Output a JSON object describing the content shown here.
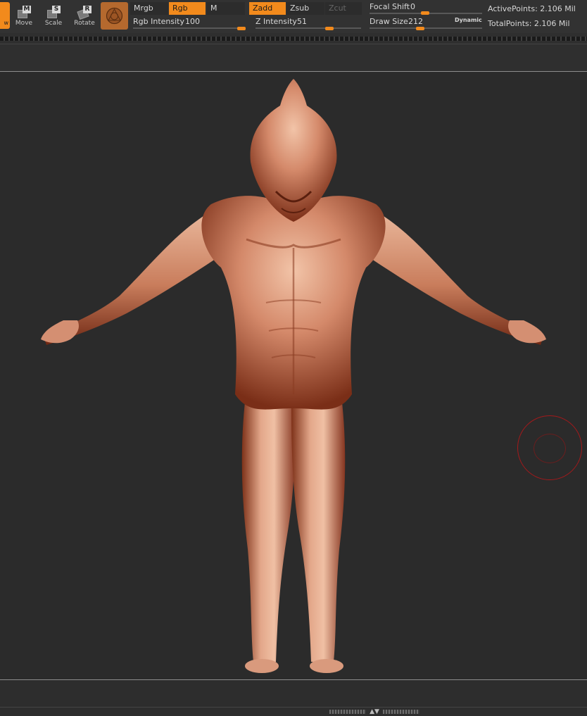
{
  "toolbar": {
    "draw_label": "w",
    "tools": [
      {
        "key": "M",
        "label": "Move"
      },
      {
        "key": "S",
        "label": "Scale"
      },
      {
        "key": "R",
        "label": "Rotate"
      }
    ],
    "mrgb": "Mrgb",
    "rgb": "Rgb",
    "m": "M",
    "zadd": "Zadd",
    "zsub": "Zsub",
    "zcut": "Zcut",
    "rgb_intensity_label": "Rgb Intensity",
    "rgb_intensity_value": "100",
    "z_intensity_label": "Z Intensity",
    "z_intensity_value": "51",
    "focal_shift_label": "Focal Shift",
    "focal_shift_value": "0",
    "draw_size_label": "Draw Size",
    "draw_size_value": "212",
    "dynamic_label": "Dynamic",
    "active_points": "ActivePoints: 2.106 Mil",
    "total_points": "TotalPoints: 2.106 Mil"
  },
  "colors": {
    "accent": "#f28a1c",
    "skin": "#c77a5a",
    "cursor": "#a5191b"
  },
  "icons": {
    "material": "material-sphere-icon",
    "move": "move-icon",
    "scale": "scale-icon",
    "rotate": "rotate-icon"
  },
  "bottom": {
    "arrows": "▲▼"
  }
}
